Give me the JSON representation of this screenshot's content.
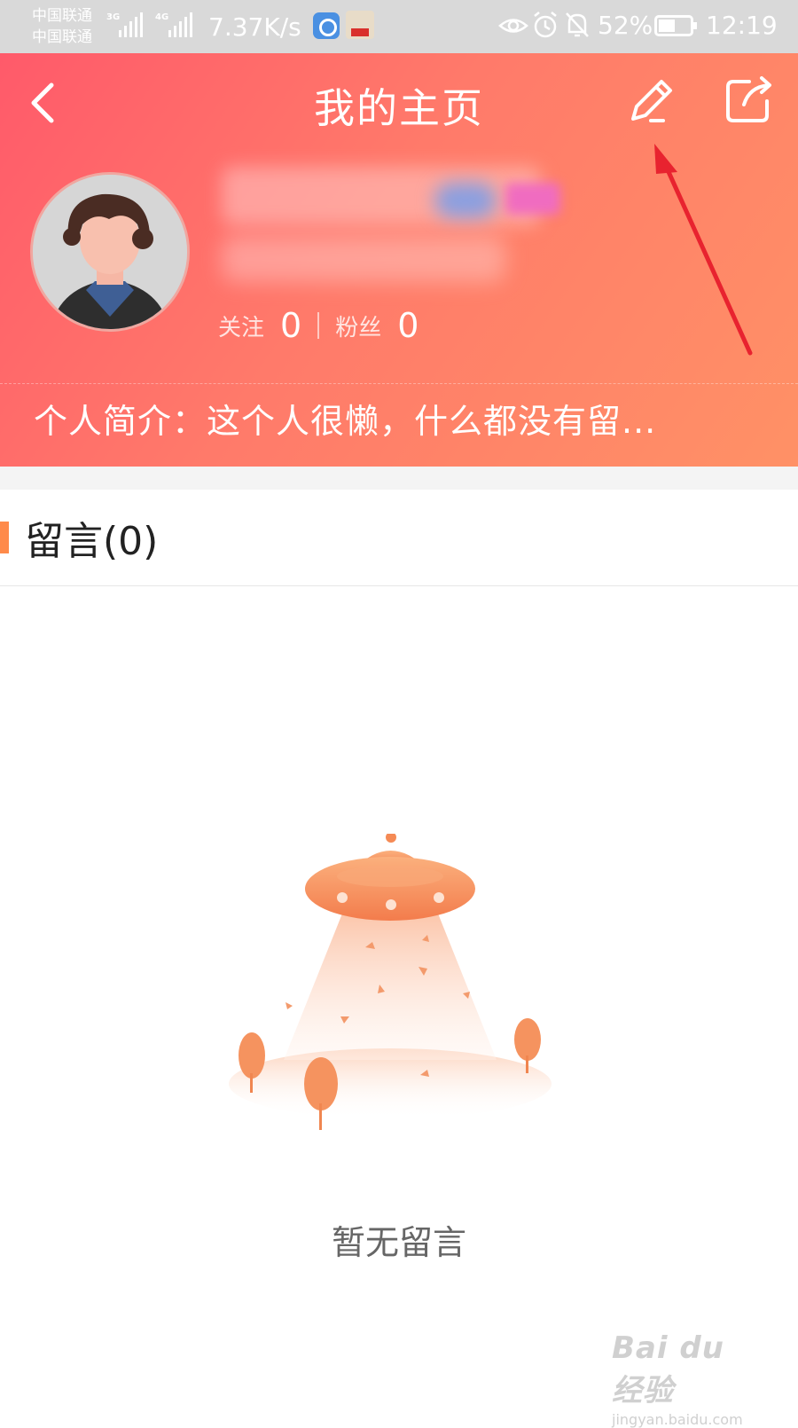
{
  "status_bar": {
    "carrier1": "中国联通",
    "carrier2": "中国联通",
    "net1": "3G",
    "net2": "4G",
    "speed": "7.37K/s",
    "battery_percent": "52%",
    "battery_level": 0.52,
    "time": "12:19",
    "icons": [
      "eye-icon",
      "alarm-icon",
      "mute-icon",
      "battery-icon"
    ]
  },
  "header": {
    "title": "我的主页",
    "icons": {
      "back": "chevron-left-icon",
      "edit": "pencil-icon",
      "share": "share-icon"
    },
    "stats": [
      {
        "label": "关注",
        "value": "0"
      },
      {
        "label": "粉丝",
        "value": "0"
      }
    ],
    "bio": "个人简介：这个人很懒，什么都没有留...",
    "gradient": [
      "#ff5a6a",
      "#ff9166"
    ]
  },
  "section": {
    "title": "留言(0)",
    "accent_color": "#ff8a4a"
  },
  "empty": {
    "text": "暂无留言",
    "illustration": "ufo-illustration"
  },
  "watermark": {
    "logo": "Bai du 经验",
    "url": "jingyan.baidu.com"
  },
  "colors": {
    "annotation_arrow": "#e8232f"
  }
}
